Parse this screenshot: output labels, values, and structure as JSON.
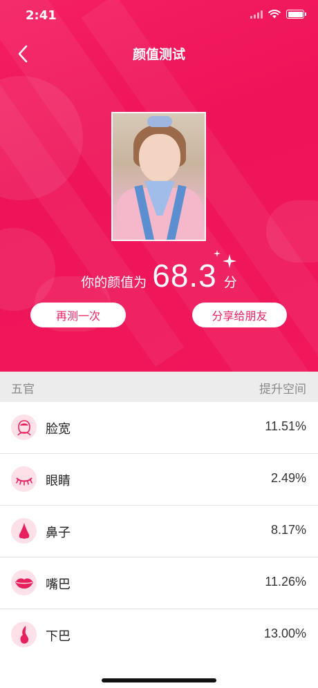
{
  "status_bar": {
    "time": "2:41"
  },
  "nav": {
    "title": "颜值测试"
  },
  "score": {
    "prefix": "你的颜值为",
    "value": "68.3",
    "suffix": "分"
  },
  "buttons": {
    "retest": "再测一次",
    "share": "分享给朋友"
  },
  "table": {
    "header_left": "五官",
    "header_right": "提升空间",
    "rows": [
      {
        "icon": "face-icon",
        "name": "脸宽",
        "value": "11.51%"
      },
      {
        "icon": "eye-icon",
        "name": "眼睛",
        "value": "2.49%"
      },
      {
        "icon": "nose-icon",
        "name": "鼻子",
        "value": "8.17%"
      },
      {
        "icon": "lips-icon",
        "name": "嘴巴",
        "value": "11.26%"
      },
      {
        "icon": "chin-icon",
        "name": "下巴",
        "value": "13.00%"
      }
    ]
  },
  "colors": {
    "accent": "#ee1459",
    "pill_text": "#e8205e",
    "icon_bg": "#fde0e8",
    "icon_fg": "#e8205e"
  }
}
